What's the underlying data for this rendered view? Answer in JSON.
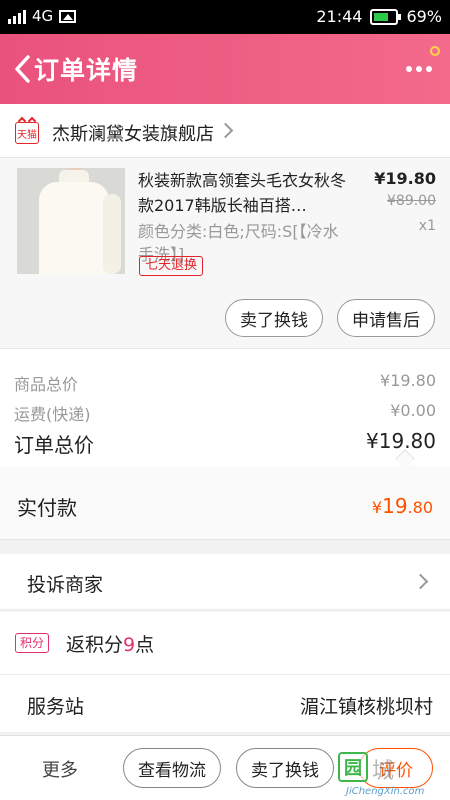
{
  "status_bar": {
    "network": "4G",
    "time": "21:44",
    "battery": "69%",
    "battery_level": 0.69
  },
  "header": {
    "title": "订单详情"
  },
  "store": {
    "badge": "天猫",
    "name": "杰斯澜黛女装旗舰店"
  },
  "product": {
    "title": "秋装新款高领套头毛衣女秋冬款2017韩版长袖百搭…",
    "attributes": "颜色分类:白色;尺码:S[【冷水手洗】]",
    "tag": "七天退换",
    "price": "¥19.80",
    "original_price": "¥89.00",
    "quantity": "x1",
    "btn_resell": "卖了换钱",
    "btn_aftersale": "申请售后"
  },
  "summary": {
    "goods_total_label": "商品总价",
    "goods_total_value": "¥19.80",
    "shipping_label": "运费(快递)",
    "shipping_value": "¥0.00",
    "order_total_label": "订单总价",
    "order_total_value": "¥19.80"
  },
  "payment": {
    "label": "实付款",
    "currency": "¥",
    "int": "19",
    "dec": ".80"
  },
  "complaint": {
    "label": "投诉商家"
  },
  "points": {
    "badge": "积分",
    "prefix": "返积分",
    "num": "9",
    "suffix": "点"
  },
  "service": {
    "label": "服务站",
    "value": "湄江镇核桃坝村"
  },
  "bottom_bar": {
    "more": "更多",
    "logistics": "查看物流",
    "resell": "卖了换钱",
    "review": "评价"
  },
  "watermark": {
    "logo": "园",
    "cn": "城",
    "url": "JiChengXin.com"
  },
  "colors": {
    "brand_pink": "#ec5a80",
    "price_orange": "#ff5000",
    "tmall_red": "#e1252b",
    "points_pink": "#e2306c"
  }
}
